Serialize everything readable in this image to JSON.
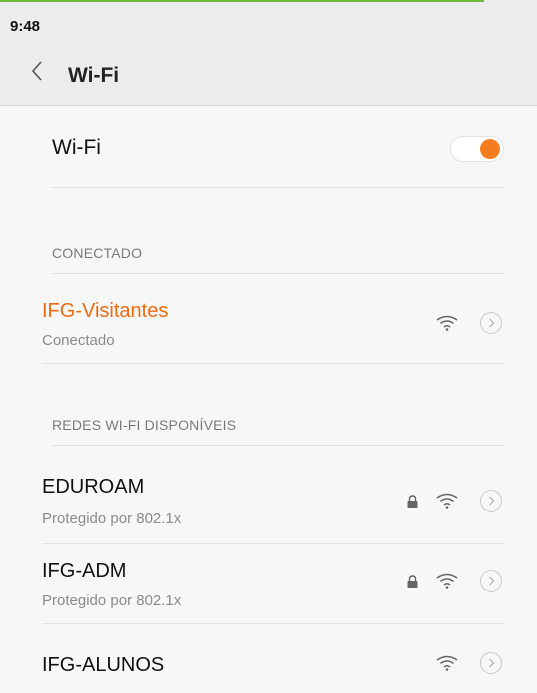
{
  "status_bar": {
    "time": "9:48"
  },
  "app_bar": {
    "back_icon": "chevron-left-icon",
    "title": "Wi-Fi"
  },
  "wifi_toggle": {
    "label": "Wi-Fi",
    "state": "on",
    "accent_color": "#f57d20"
  },
  "connected_section": {
    "header": "CONECTADO",
    "network": {
      "name": "IFG-Visitantes",
      "status": "Conectado",
      "name_color": "#f06a10",
      "icons": [
        "wifi-icon",
        "chevron-right-icon"
      ]
    }
  },
  "available_section": {
    "header": "REDES WI-FI DISPONÍVEIS",
    "networks": [
      {
        "name": "EDUROAM",
        "status": "Protegido por 802.1x",
        "icons": [
          "lock-icon",
          "wifi-icon",
          "chevron-right-icon"
        ]
      },
      {
        "name": "IFG-ADM",
        "status": "Protegido por 802.1x",
        "icons": [
          "lock-icon",
          "wifi-icon",
          "chevron-right-icon"
        ]
      },
      {
        "name": "IFG-ALUNOS",
        "status": "",
        "icons": [
          "wifi-icon",
          "chevron-right-icon"
        ]
      }
    ]
  }
}
